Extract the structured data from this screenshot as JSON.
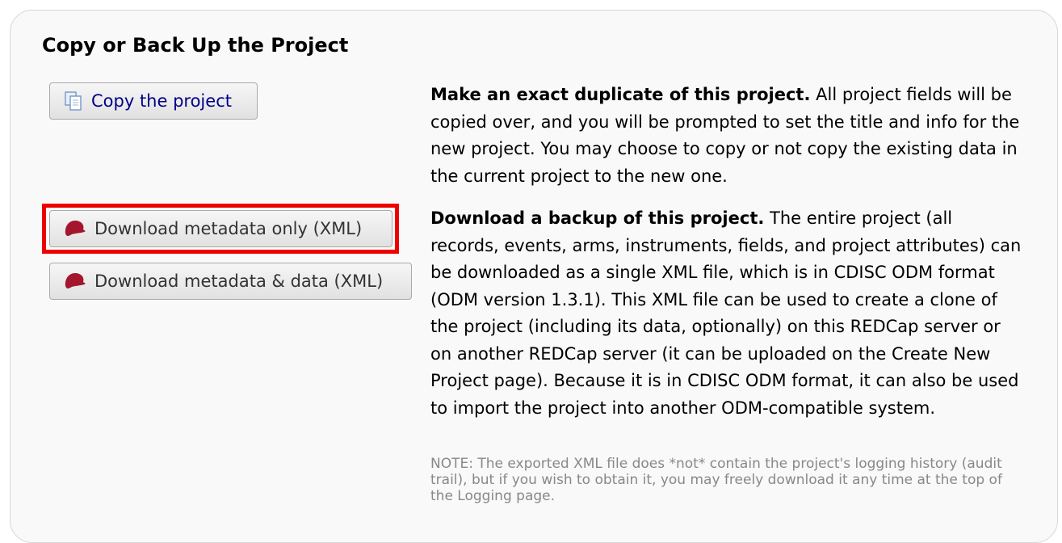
{
  "section": {
    "title": "Copy or Back Up the Project"
  },
  "buttons": {
    "copy_project": "Copy the project",
    "download_metadata_only": "Download metadata only (XML)",
    "download_metadata_data": "Download metadata & data (XML)"
  },
  "copy_description": {
    "bold": "Make an exact duplicate of this project.",
    "text": " All project fields will be copied over, and you will be prompted to set the title and info for the new project. You may choose to copy or not copy the existing data in the current project to the new one."
  },
  "backup_description": {
    "bold": "Download a backup of this project.",
    "text": " The entire project (all records, events, arms, instruments, fields, and project attributes) can be downloaded as a single XML file, which is in CDISC ODM format (ODM version 1.3.1). This XML file can be used to create a clone of the project (including its data, optionally) on this REDCap server or on another REDCap server (it can be uploaded on the Create New Project page). Because it is in CDISC ODM format, it can also be used to import the project into another ODM-compatible system."
  },
  "note": "NOTE: The exported XML file does *not* contain the project's logging history (audit trail), but if you wish to obtain it, you may freely download it any time at the top of the Logging page.",
  "icons": {
    "copy": "copy-pages-icon",
    "download": "redcap-hat-icon"
  },
  "colors": {
    "highlight": "#ee0000",
    "link_text": "#000088",
    "hat": "#a4162d",
    "note": "#888888"
  }
}
